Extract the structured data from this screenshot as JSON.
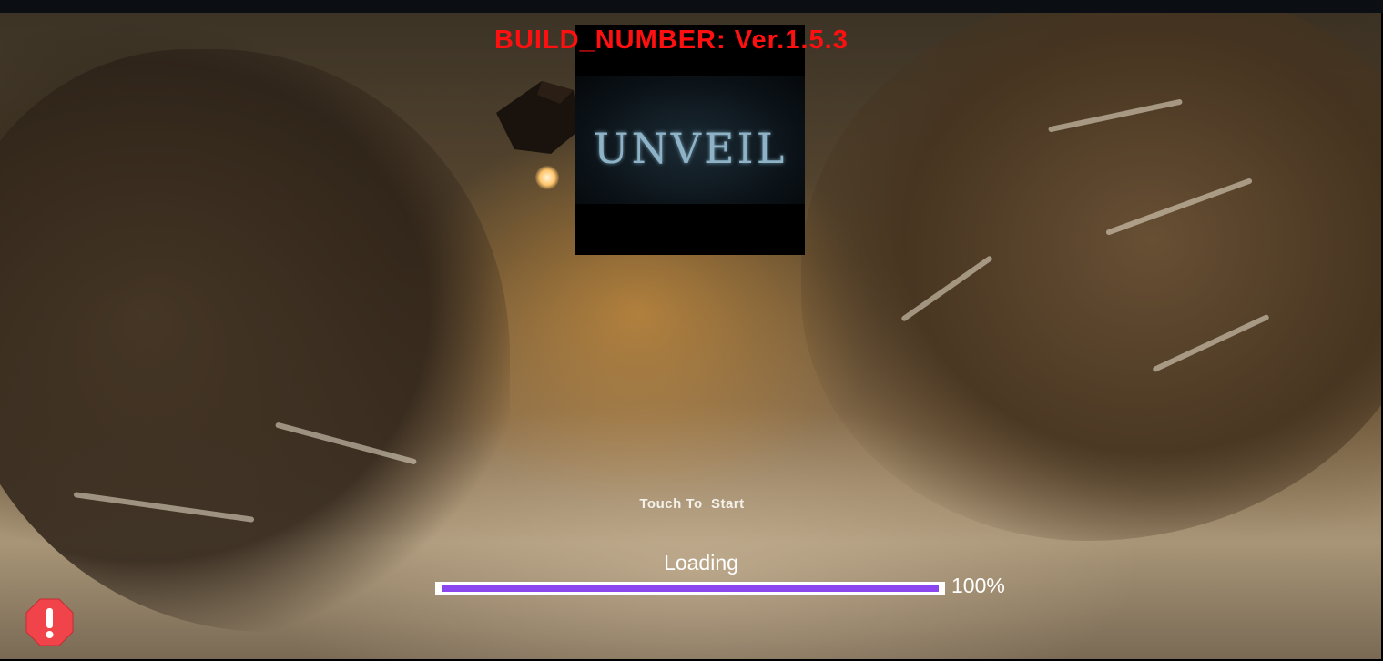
{
  "build": {
    "label": "BUILD_NUMBER: Ver.1.5.3"
  },
  "logo": {
    "text": "UNVEIL"
  },
  "start": {
    "label": "Touch To  Start"
  },
  "loading": {
    "label": "Loading",
    "progress": 1.0,
    "percent_text": "100%",
    "fill_color": "#8c46f0"
  },
  "colors": {
    "build_text": "#ff1010",
    "alert": "#f0444a"
  },
  "icons": {
    "alert": "alert-octagon-icon"
  }
}
